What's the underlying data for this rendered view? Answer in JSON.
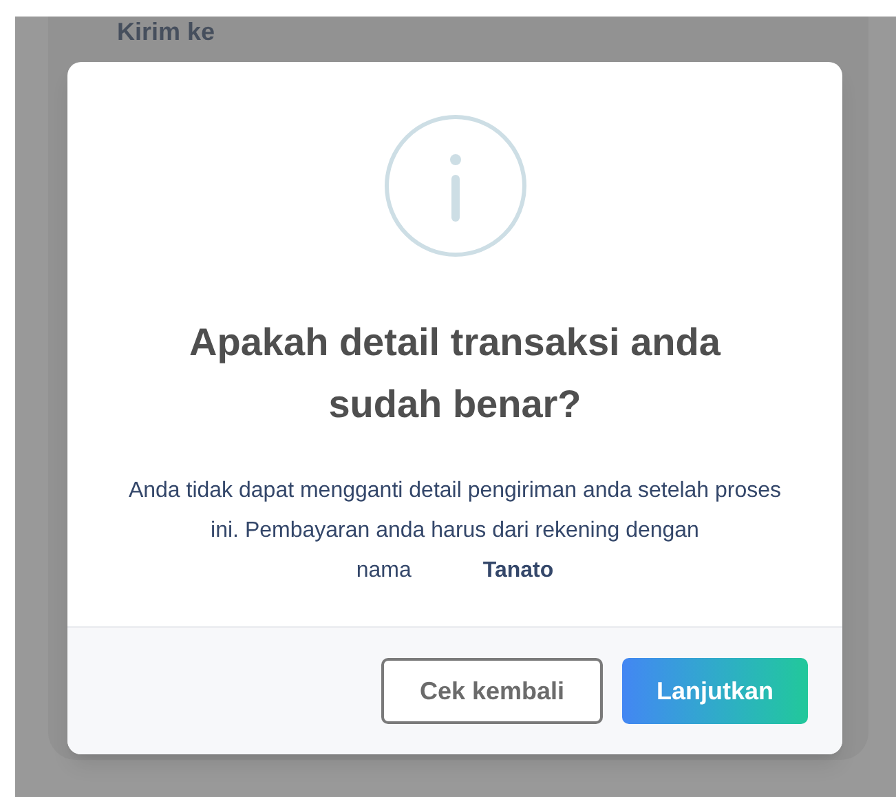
{
  "background": {
    "heading": "Kirim ke"
  },
  "dialog": {
    "title": "Apakah detail transaksi anda sudah benar?",
    "message": "Anda tidak dapat mengganti detail pengiriman anda setelah proses ini. Pembayaran anda harus dari rekening dengan nama",
    "account_name": "Tanato",
    "buttons": [
      {
        "label": "Cek kembali",
        "kind": "secondary"
      },
      {
        "label": "Lanjutkan",
        "kind": "primary"
      }
    ]
  }
}
